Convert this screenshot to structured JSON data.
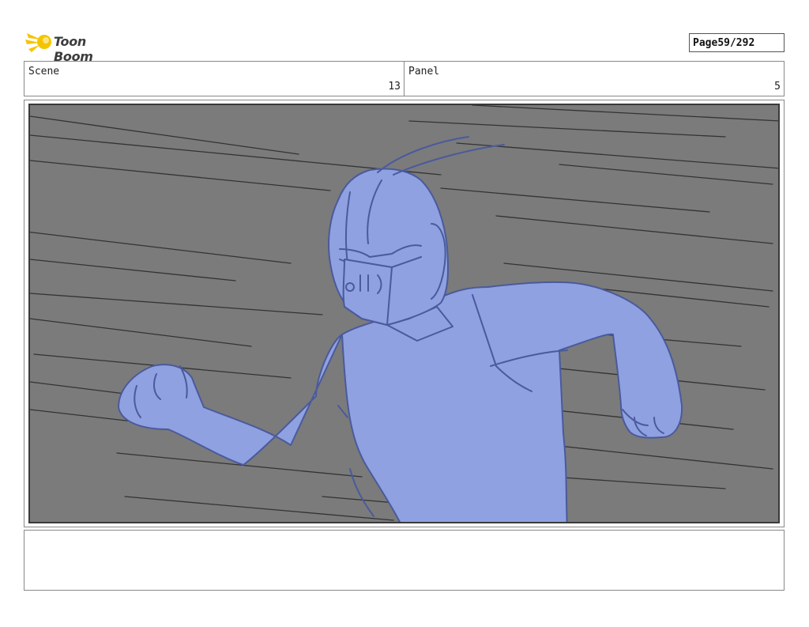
{
  "brand": {
    "logo_text": "Toon Boom"
  },
  "page": {
    "label": "Page",
    "number": "59/292"
  },
  "scene": {
    "label": "Scene",
    "value": "13"
  },
  "panel": {
    "label": "Panel",
    "value": "5"
  },
  "colors": {
    "background": "#7b7b7b",
    "character_fill": "#8fa1e0",
    "character_line": "#4a5a9c",
    "speed_lines": "#333333",
    "logo_yellow": "#f5c400"
  },
  "notes": {
    "text": ""
  }
}
